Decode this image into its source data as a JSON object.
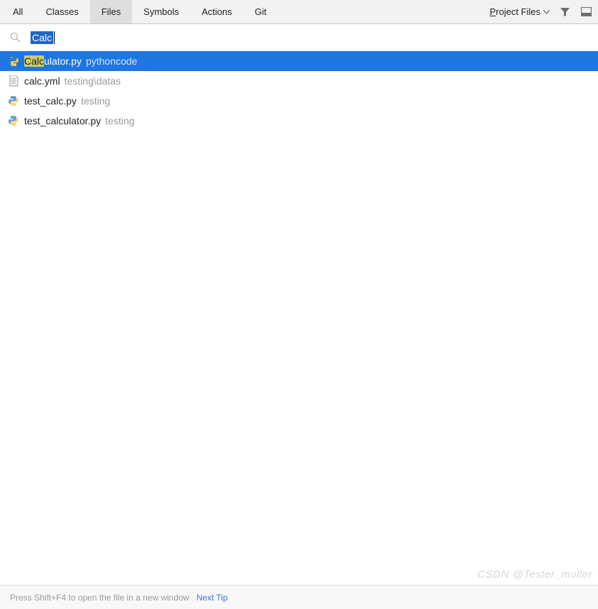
{
  "tabs": {
    "all": "All",
    "classes": "Classes",
    "files": "Files",
    "symbols": "Symbols",
    "actions": "Actions",
    "git": "Git",
    "active": "files"
  },
  "scope": {
    "label_rest": "roject Files",
    "label_first": "P"
  },
  "search": {
    "value": "Calc"
  },
  "results": [
    {
      "icon": "python",
      "highlight": "Calc",
      "name_rest": "ulator.py",
      "path": "pythoncode",
      "selected": true
    },
    {
      "icon": "yml",
      "highlight": "",
      "name_rest": "calc.yml",
      "path": "testing\\datas",
      "selected": false
    },
    {
      "icon": "python",
      "highlight": "",
      "name_rest": "test_calc.py",
      "path": "testing",
      "selected": false
    },
    {
      "icon": "python",
      "highlight": "",
      "name_rest": "test_calculator.py",
      "path": "testing",
      "selected": false
    }
  ],
  "footer": {
    "hint": "Press Shift+F4 to open the file in a new window",
    "link": "Next Tip"
  },
  "watermark": "CSDN @Tester_muller"
}
